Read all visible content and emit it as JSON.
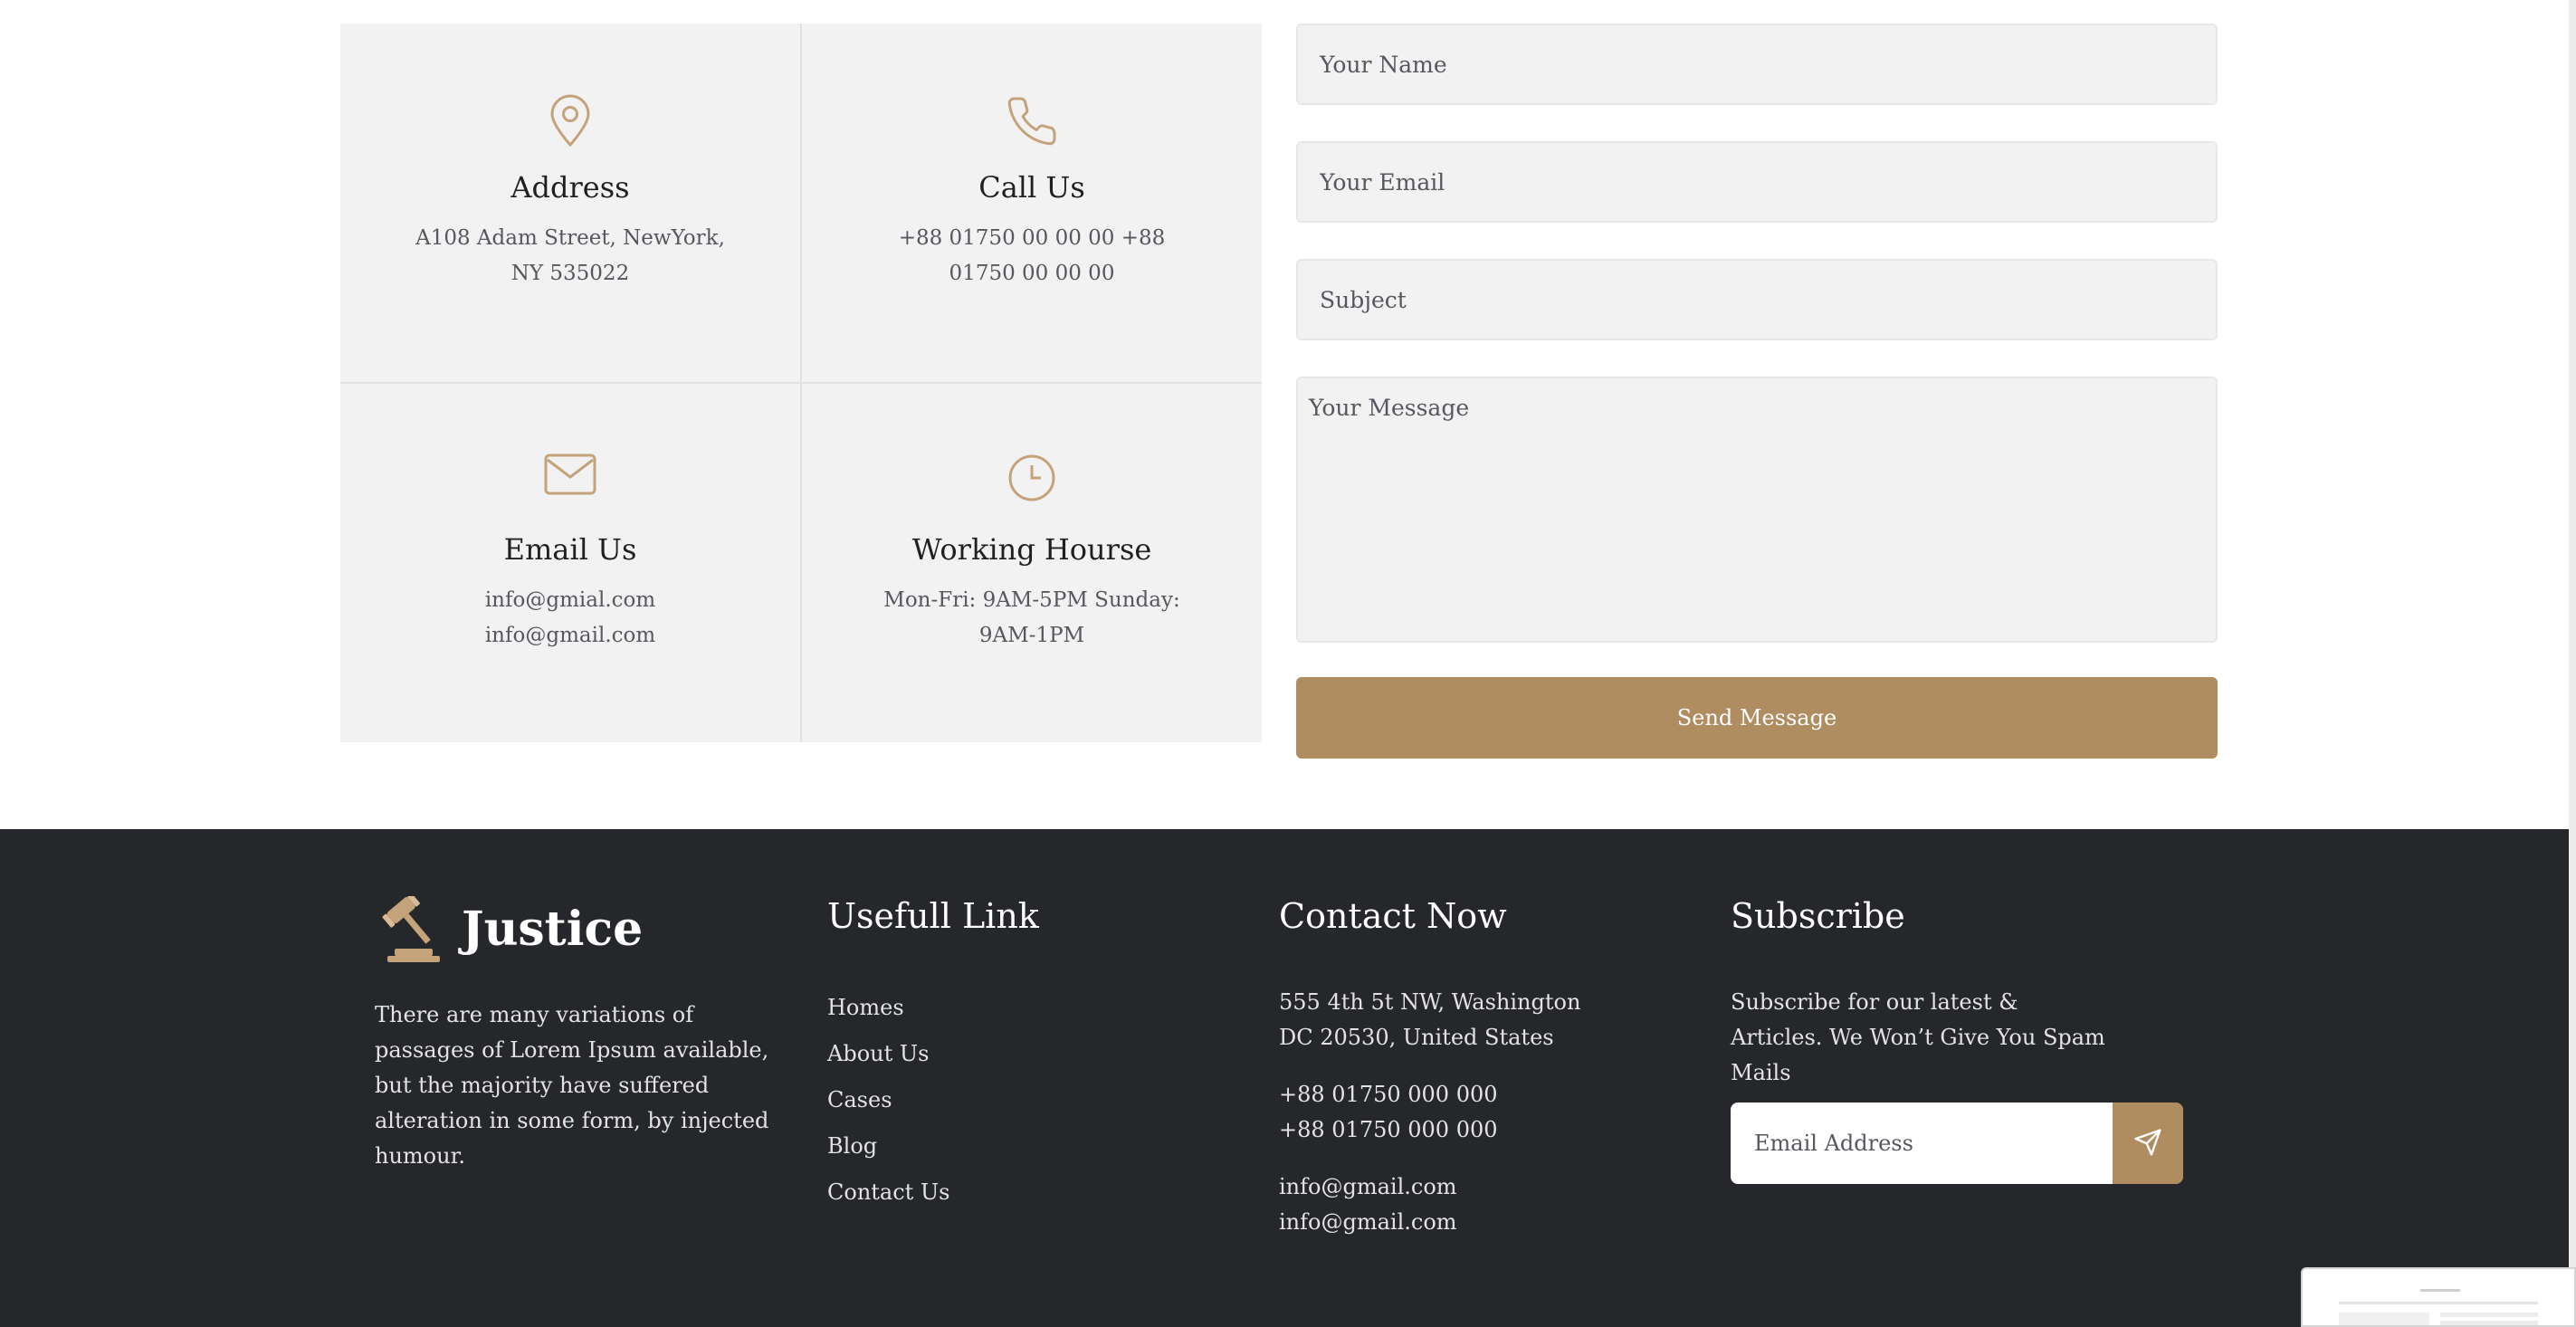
{
  "info_cards": [
    {
      "icon": "location-pin-icon",
      "title": "Address",
      "detail": "A108 Adam Street, NewYork, NY 535022"
    },
    {
      "icon": "phone-icon",
      "title": "Call Us",
      "detail": "+88 01750 00 00 00 +88 01750 00 00 00"
    },
    {
      "icon": "envelope-icon",
      "title": "Email Us",
      "detail": "info@gmial.com info@gmail.com"
    },
    {
      "icon": "clock-icon",
      "title": "Working Hourse",
      "detail": "Mon-Fri: 9AM-5PM Sunday: 9AM-1PM"
    }
  ],
  "form": {
    "name_placeholder": "Your Name",
    "email_placeholder": "Your Email",
    "subject_placeholder": "Subject",
    "message_placeholder": "Your Message",
    "send_label": "Send Message"
  },
  "footer": {
    "logo_text": "Justice",
    "about": "There are many variations of passages of Lorem Ipsum available, but the majority have suffered alteration in some form, by injected humour.",
    "links_heading": "Usefull Link",
    "links": [
      "Homes",
      "About Us",
      "Cases",
      "Blog",
      "Contact Us"
    ],
    "contact_heading": "Contact Now",
    "contact_lines": [
      "555 4th 5t NW, Washington",
      "DC 20530, United States",
      "+88 01750 000 000",
      "+88 01750 000 000",
      "info@gmail.com",
      "info@gmail.com"
    ],
    "subscribe_heading": "Subscribe",
    "subscribe_text": "Subscribe for our latest & Articles. We Won’t Give You Spam Mails",
    "email_placeholder": "Email Address",
    "subscribe_icon": "send-icon"
  },
  "colors": {
    "accent": "#b08d61",
    "footer_bg": "#25272b",
    "card_bg": "#f2f2f2"
  }
}
